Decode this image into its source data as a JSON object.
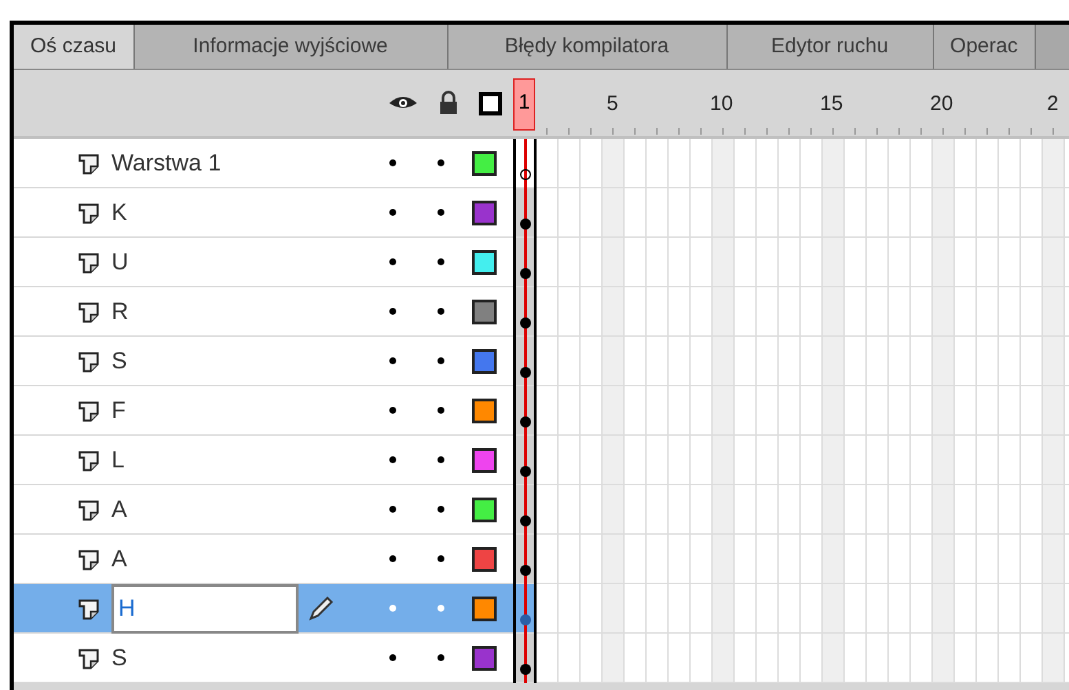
{
  "tabs": [
    {
      "label": "Oś czasu",
      "selected": true
    },
    {
      "label": "Informacje wyjściowe",
      "selected": false
    },
    {
      "label": "Błędy kompilatora",
      "selected": false
    },
    {
      "label": "Edytor ruchu",
      "selected": false
    },
    {
      "label": "Operac",
      "selected": false
    }
  ],
  "ruler": {
    "current_frame": "1",
    "labels": [
      "5",
      "10",
      "15",
      "20",
      "2"
    ]
  },
  "layers": [
    {
      "name": "Warstwa 1",
      "color": "#44ee44",
      "selected": false,
      "keyframe_hollow": true
    },
    {
      "name": "K",
      "color": "#9933cc",
      "selected": false,
      "keyframe_hollow": false
    },
    {
      "name": "U",
      "color": "#44eeee",
      "selected": false,
      "keyframe_hollow": false
    },
    {
      "name": "R",
      "color": "#808080",
      "selected": false,
      "keyframe_hollow": false
    },
    {
      "name": "S",
      "color": "#4477ee",
      "selected": false,
      "keyframe_hollow": false
    },
    {
      "name": "F",
      "color": "#ff8800",
      "selected": false,
      "keyframe_hollow": false
    },
    {
      "name": "L",
      "color": "#ee44ee",
      "selected": false,
      "keyframe_hollow": false
    },
    {
      "name": "A",
      "color": "#44ee44",
      "selected": false,
      "keyframe_hollow": false
    },
    {
      "name": "A",
      "color": "#ee4444",
      "selected": false,
      "keyframe_hollow": false
    },
    {
      "name": "H",
      "color": "#ff8800",
      "selected": true,
      "keyframe_hollow": false
    },
    {
      "name": "S",
      "color": "#9933cc",
      "selected": false,
      "keyframe_hollow": false
    }
  ]
}
